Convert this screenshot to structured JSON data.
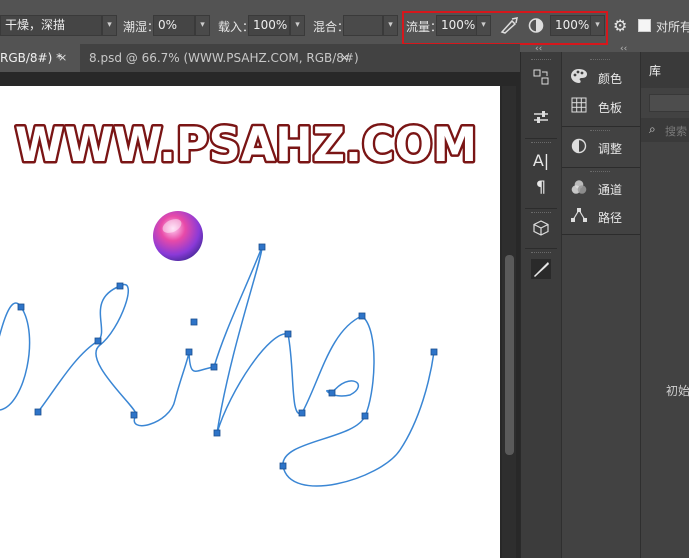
{
  "options_bar": {
    "mode_value": "干燥，深描",
    "wet_label": "潮湿：",
    "wet_value": "0%",
    "load_label": "载入：",
    "load_value": "100%",
    "mix_label": "混合：",
    "flow_label": "流量：",
    "flow_value": "100%",
    "smoothing_value": "100%",
    "sample_all_label": "对所有"
  },
  "tabs": [
    {
      "label": "RGB/8#) *",
      "close": "×"
    },
    {
      "label": "8.psd @ 66.7% (WWW.PSAHZ.COM, RGB/8#)",
      "close": "×"
    }
  ],
  "canvas": {
    "watermark": "WWW.PSAHZ.COM",
    "path_text": "psahz"
  },
  "panels": {
    "collapse_glyph": "‹‹",
    "items": [
      {
        "label": "颜色",
        "icon": "palette-icon"
      },
      {
        "label": "色板",
        "icon": "swatches-icon"
      },
      {
        "label": "调整",
        "icon": "adjustments-icon"
      },
      {
        "label": "通道",
        "icon": "channels-icon"
      },
      {
        "label": "路径",
        "icon": "paths-icon"
      }
    ],
    "library": {
      "tab": "库",
      "search_placeholder": "搜索",
      "initial_text": "初始"
    }
  }
}
